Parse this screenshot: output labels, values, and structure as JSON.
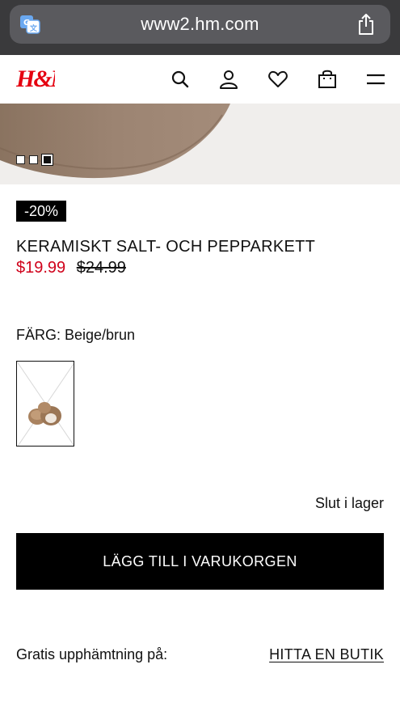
{
  "browser": {
    "url": "www2.hm.com",
    "translate_icon": "translate-icon",
    "share_icon": "share-icon"
  },
  "header": {
    "logo": "H&M",
    "icons": [
      "search-icon",
      "account-icon",
      "heart-icon",
      "bag-icon",
      "menu-icon"
    ]
  },
  "gallery": {
    "dot_count": 3,
    "active_index": 2
  },
  "product": {
    "discount_badge": "-20%",
    "title": "KERAMISKT SALT- OCH PEPPARKETT",
    "price_sale": "$19.99",
    "price_original": "$24.99",
    "color_label": "FÄRG: Beige/brun",
    "stock_status": "Slut i lager",
    "add_to_cart": "LÄGG TILL I VARUKORGEN"
  },
  "pickup": {
    "label": "Gratis upphämtning på:",
    "find_store": "HITTA EN BUTIK"
  },
  "colors": {
    "sale_red": "#d0021b",
    "browser_bar": "#3a3a3c",
    "url_pill": "#5a5a5e",
    "brand_red": "#e50010"
  }
}
